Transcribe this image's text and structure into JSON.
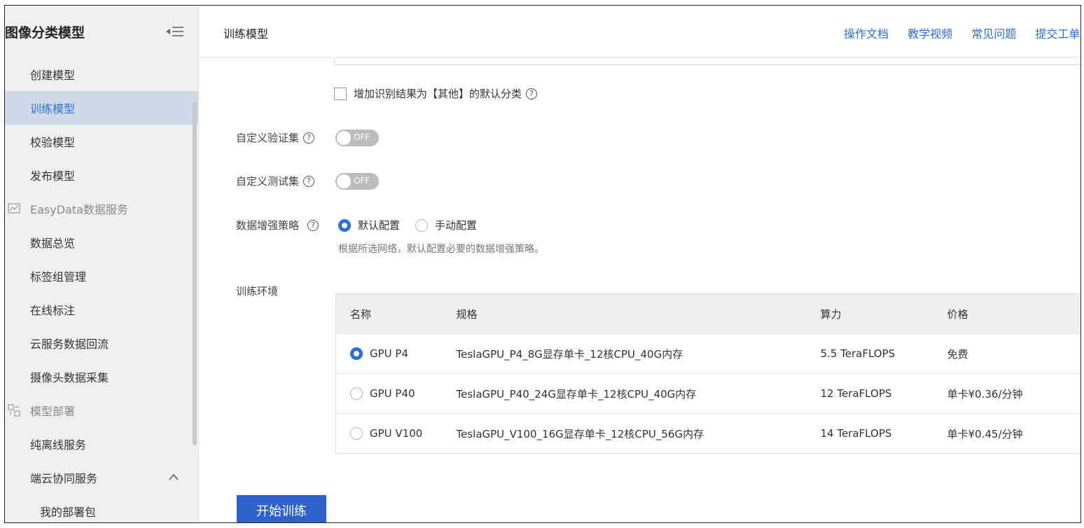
{
  "sidebar": {
    "title": "图像分类模型",
    "items": [
      {
        "label": "创建模型",
        "type": "item"
      },
      {
        "label": "训练模型",
        "type": "item",
        "active": true
      },
      {
        "label": "校验模型",
        "type": "item"
      },
      {
        "label": "发布模型",
        "type": "item"
      },
      {
        "label": "EasyData数据服务",
        "type": "group"
      },
      {
        "label": "数据总览",
        "type": "item"
      },
      {
        "label": "标签组管理",
        "type": "item"
      },
      {
        "label": "在线标注",
        "type": "item"
      },
      {
        "label": "云服务数据回流",
        "type": "item"
      },
      {
        "label": "摄像头数据采集",
        "type": "item"
      },
      {
        "label": "模型部署",
        "type": "group"
      },
      {
        "label": "纯离线服务",
        "type": "item"
      },
      {
        "label": "端云协同服务",
        "type": "item"
      },
      {
        "label": "我的部署包",
        "type": "sub"
      }
    ]
  },
  "header": {
    "page_title": "训练模型",
    "links": [
      "操作文档",
      "教学视频",
      "常见问题",
      "提交工单"
    ]
  },
  "form": {
    "checkbox_label": "增加识别结果为【其他】的默认分类",
    "custom_val_label": "自定义验证集",
    "custom_test_label": "自定义测试集",
    "toggle_off": "OFF",
    "aug_label": "数据增强策略",
    "aug_default": "默认配置",
    "aug_manual": "手动配置",
    "aug_hint": "根据所选网络，默认配置必要的数据增强策略。",
    "env_label": "训练环境",
    "help_glyph": "?"
  },
  "env_table": {
    "headers": [
      "名称",
      "规格",
      "算力",
      "价格"
    ],
    "rows": [
      {
        "name": "GPU P4",
        "spec": "TeslaGPU_P4_8G显存单卡_12核CPU_40G内存",
        "power": "5.5 TeraFLOPS",
        "price": "免费",
        "selected": true
      },
      {
        "name": "GPU P40",
        "spec": "TeslaGPU_P40_24G显存单卡_12核CPU_40G内存",
        "power": "12 TeraFLOPS",
        "price": "单卡¥0.36/分钟",
        "selected": false
      },
      {
        "name": "GPU V100",
        "spec": "TeslaGPU_V100_16G显存单卡_12核CPU_56G内存",
        "power": "14 TeraFLOPS",
        "price": "单卡¥0.45/分钟",
        "selected": false
      }
    ]
  },
  "actions": {
    "start_label": "开始训练"
  },
  "colors": {
    "accent": "#2d6fd6",
    "button": "#2f62c8",
    "active_bg": "#cfd9ea"
  }
}
